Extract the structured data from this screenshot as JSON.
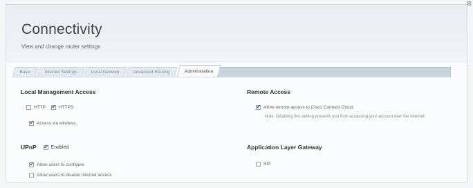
{
  "header": {
    "title": "Connectivity",
    "subtitle": "View and change router settings",
    "close_glyph": "⊠"
  },
  "tabs": [
    {
      "label": "Basic"
    },
    {
      "label": "Internet Settings"
    },
    {
      "label": "Local Network"
    },
    {
      "label": "Advanced Routing"
    },
    {
      "label": "Administration",
      "active": true
    }
  ],
  "local_management": {
    "title": "Local Management Access",
    "http_label": "HTTP",
    "http_checked": false,
    "https_label": "HTTPS",
    "https_checked": true,
    "wireless_label": "Access via wireless",
    "wireless_checked": true
  },
  "remote_access": {
    "title": "Remote Access",
    "cloud_label": "Allow remote access to Cisco Connect Cloud",
    "cloud_checked": true,
    "note": "Note: Disabling this setting prevents you from accessing your account over the Internet."
  },
  "upnp": {
    "title": "UPnP",
    "enabled_label": "Enabled",
    "enabled_checked": true,
    "configure_label": "Allow users to configure",
    "configure_checked": true,
    "disable_label": "Allow users to disable Internet access",
    "disable_checked": false
  },
  "alg": {
    "title": "Application Layer Gateway",
    "sip_label": "SIP",
    "sip_checked": false
  }
}
